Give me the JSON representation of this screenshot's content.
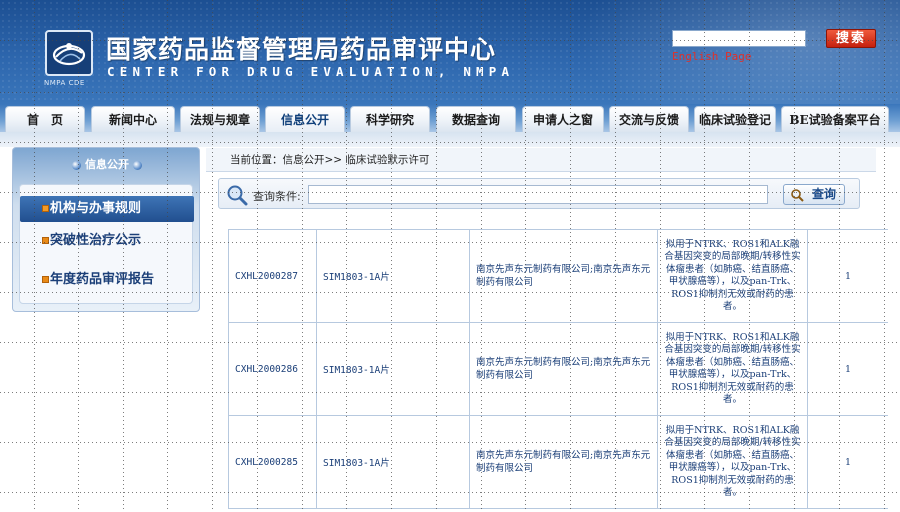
{
  "header": {
    "title": "国家药品监督管理局药品审评中心",
    "subtitle": "CENTER FOR DRUG EVALUATION, NMPA",
    "logo_text": "NMPA CDE",
    "search_placeholder": "",
    "search_button": "搜索",
    "english_link": "English Page"
  },
  "nav": {
    "tabs": [
      {
        "label": "首　页",
        "active": false
      },
      {
        "label": "新闻中心",
        "active": false
      },
      {
        "label": "法规与规章",
        "active": false
      },
      {
        "label": "信息公开",
        "active": true
      },
      {
        "label": "科学研究",
        "active": false
      },
      {
        "label": "数据查询",
        "active": false
      },
      {
        "label": "申请人之窗",
        "active": false
      },
      {
        "label": "交流与反馈",
        "active": false
      },
      {
        "label": "临床试验登记",
        "active": false
      },
      {
        "label": "BE试验备案平台",
        "active": false
      }
    ]
  },
  "sidebar": {
    "title": "信息公开",
    "items": [
      {
        "label": "机构与办事规则",
        "active": true
      },
      {
        "label": "突破性治疗公示",
        "active": false
      },
      {
        "label": "年度药品审评报告",
        "active": false
      }
    ]
  },
  "breadcrumb": "当前位置：信息公开>> 临床试验默示许可",
  "query": {
    "label": "查询条件:",
    "value": "",
    "button": "查询"
  },
  "results": {
    "rows": [
      {
        "code": "CXHL2000287",
        "drug_name": "SIM1803-1A片",
        "company": "南京先声东元制药有限公司;南京先声东元制药有限公司",
        "indication": "拟用于NTRK、ROS1和ALK融合基因突变的局部晚期/转移性实体瘤患者（如肺癌、结直肠癌、甲状腺癌等），以及pan-Trk、ROS1抑制剂无效或耐药的患者。",
        "count": "1"
      },
      {
        "code": "CXHL2000286",
        "drug_name": "SIM1803-1A片",
        "company": "南京先声东元制药有限公司;南京先声东元制药有限公司",
        "indication": "拟用于NTRK、ROS1和ALK融合基因突变的局部晚期/转移性实体瘤患者（如肺癌、结直肠癌、甲状腺癌等），以及pan-Trk、ROS1抑制剂无效或耐药的患者。",
        "count": "1"
      },
      {
        "code": "CXHL2000285",
        "drug_name": "SIM1803-1A片",
        "company": "南京先声东元制药有限公司;南京先声东元制药有限公司",
        "indication": "拟用于NTRK、ROS1和ALK融合基因突变的局部晚期/转移性实体瘤患者（如肺癌、结直肠癌、甲状腺癌等），以及pan-Trk、ROS1抑制剂无效或耐药的患者。",
        "count": "1"
      }
    ]
  },
  "colors": {
    "header_blue": "#2d66ad",
    "search_red": "#c4200e",
    "link_red": "#e0302a",
    "text_blue": "#1b3f78",
    "bullet_orange": "#e98a17"
  }
}
